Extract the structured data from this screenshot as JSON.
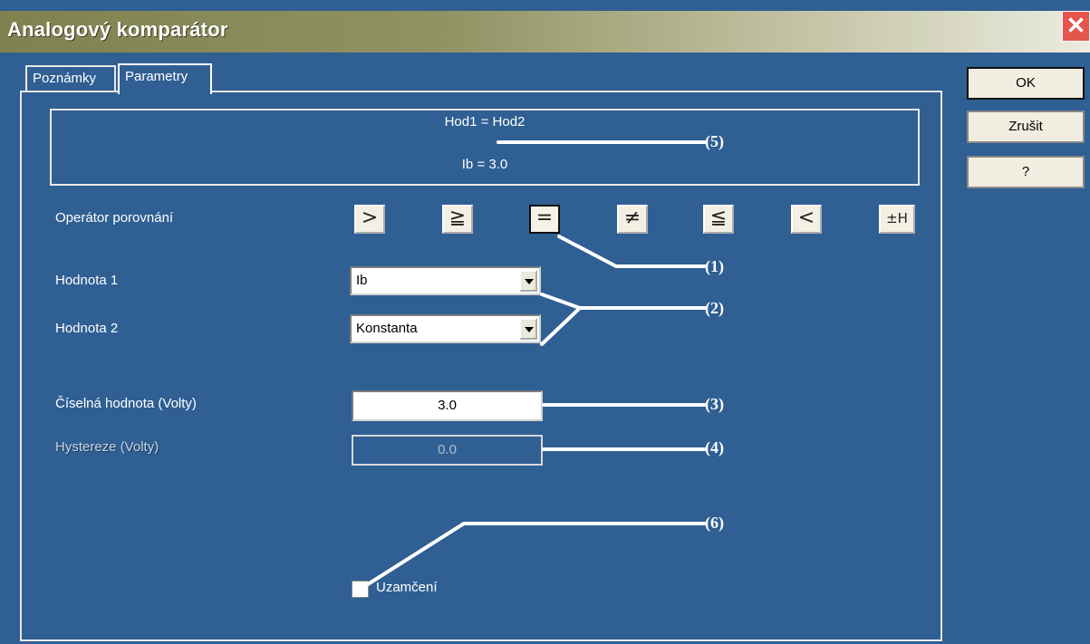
{
  "window": {
    "title": "Analogový komparátor",
    "close_glyph": "✕"
  },
  "tabs": [
    {
      "label": "Poznámky"
    },
    {
      "label": "Parametry"
    }
  ],
  "summary": {
    "line1": "Hod1 = Hod2",
    "line2": "Ib = 3.0"
  },
  "operator": {
    "label": "Operátor porovnání",
    "buttons": [
      ">",
      "≧",
      "=",
      "≠",
      "≦",
      "<",
      "±H"
    ],
    "selected": "="
  },
  "value1": {
    "label": "Hodnota 1",
    "selected": "Ib"
  },
  "value2": {
    "label": "Hodnota 2",
    "selected": "Konstanta"
  },
  "numeric": {
    "label": "Číselná hodnota (Volty)",
    "value": "3.0"
  },
  "hysteresis": {
    "label": "Hystereze (Volty)",
    "value": "0.0",
    "disabled": true
  },
  "lock": {
    "label": "Uzamčení",
    "checked": false
  },
  "side_buttons": {
    "ok": "OK",
    "cancel": "Zrušit",
    "help": "?"
  },
  "callouts": [
    "(1)",
    "(2)",
    "(3)",
    "(4)",
    "(5)",
    "(6)"
  ],
  "colors": {
    "background": "#2f5f93",
    "accent_title": "#8f9262",
    "close": "#e4564b"
  }
}
